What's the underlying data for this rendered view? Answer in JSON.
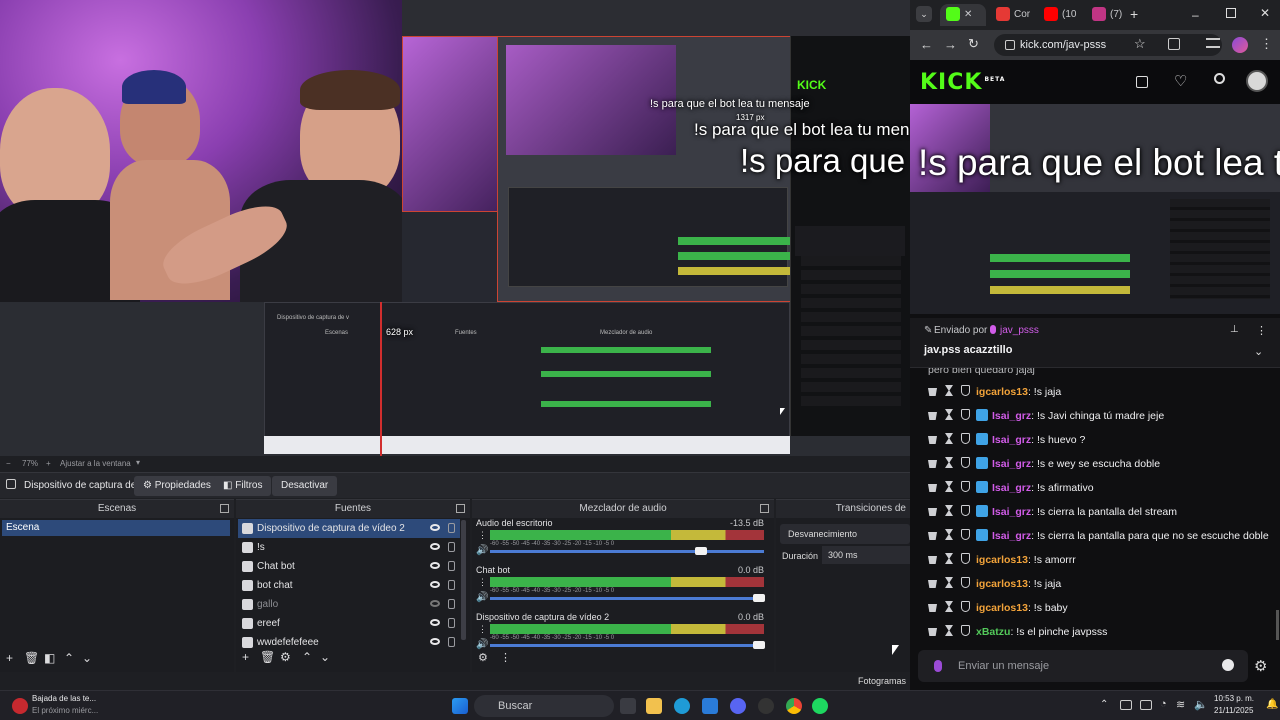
{
  "overlay": {
    "command_message": "!s para que el bot lea tu mensaje",
    "size_label_1": "628 px",
    "size_label_2": "1317 px"
  },
  "obs": {
    "zoom": "77%",
    "fit_label": "Ajustar a la ventana",
    "selected_source": "Dispositivo de captura de v",
    "properties": "Propiedades",
    "filters": "Filtros",
    "deactivate": "Desactivar",
    "docks": {
      "scenes": "Escenas",
      "sources": "Fuentes",
      "mixer": "Mezclador de audio",
      "transitions": "Transiciones de"
    },
    "scenes": [
      "Escena"
    ],
    "sources": [
      {
        "label": "Dispositivo de captura de vídeo 2",
        "visible": true
      },
      {
        "label": "!s",
        "visible": true
      },
      {
        "label": "Chat bot",
        "visible": true
      },
      {
        "label": "bot chat",
        "visible": true
      },
      {
        "label": "gallo",
        "visible": false
      },
      {
        "label": "ereef",
        "visible": true
      },
      {
        "label": "wwdefefefeee",
        "visible": true
      }
    ],
    "mixer": [
      {
        "name": "Audio del escritorio",
        "db": "-13.5 dB",
        "level": 0.77
      },
      {
        "name": "Chat bot",
        "db": "0.0 dB",
        "level": 0.98
      },
      {
        "name": "Dispositivo de captura de vídeo 2",
        "db": "0.0 dB",
        "level": 0.98
      }
    ],
    "meter_scale": "-60 -55 -50 -45 -40 -35 -30 -25 -20 -15 -10 -5 0",
    "transition": "Desvanecimiento",
    "duration_label": "Duración",
    "duration_value": "300 ms",
    "frames_label": "Fotogramas"
  },
  "browser": {
    "tabs": [
      {
        "label": "Cor",
        "color": "#e53935"
      },
      {
        "label": "(10",
        "color": "#ff0000"
      },
      {
        "label": "(7)",
        "color": "#c13584"
      }
    ],
    "url": "kick.com/jav-psss",
    "logo": "KICK",
    "logo_sup": "BETA"
  },
  "kick": {
    "pinned_by": "Enviado por",
    "pinned_user": "jav_psss",
    "pinned_text": "jav.pss acazztillo",
    "partial_line": "pero bien quedaro jajaj",
    "messages": [
      {
        "user": "igcarlos13",
        "text": ": !s jaja",
        "color": "#f2a33a",
        "verified": false
      },
      {
        "user": "Isai_grz",
        "text": ": !s Javi chinga tú madre jeje",
        "color": "#d15ce8",
        "verified": true
      },
      {
        "user": "Isai_grz",
        "text": ": !s huevo ?",
        "color": "#d15ce8",
        "verified": true
      },
      {
        "user": "Isai_grz",
        "text": ": !s e wey se escucha doble",
        "color": "#d15ce8",
        "verified": true
      },
      {
        "user": "Isai_grz",
        "text": ": !s afirmativo",
        "color": "#d15ce8",
        "verified": true
      },
      {
        "user": "Isai_grz",
        "text": ": !s cierra la pantalla del stream",
        "color": "#d15ce8",
        "verified": true
      },
      {
        "user": "Isai_grz",
        "text": ": !s cierra la pantalla para que no se escuche doble",
        "color": "#d15ce8",
        "verified": true
      },
      {
        "user": "igcarlos13",
        "text": ": !s amorrr",
        "color": "#f2a33a",
        "verified": false
      },
      {
        "user": "igcarlos13",
        "text": ": !s jaja",
        "color": "#f2a33a",
        "verified": false
      },
      {
        "user": "igcarlos13",
        "text": ": !s baby",
        "color": "#f2a33a",
        "verified": false
      },
      {
        "user": "xBatzu",
        "text": ": !s el pinche javpsss",
        "color": "#53c95a",
        "verified": false
      }
    ],
    "input_placeholder": "Enviar un mensaje"
  },
  "taskbar": {
    "notif_title": "Bajada de las te...",
    "notif_sub": "El próximo miérc...",
    "search": "Buscar",
    "time": "10:53 p. m.",
    "date": "21/11/2025"
  }
}
